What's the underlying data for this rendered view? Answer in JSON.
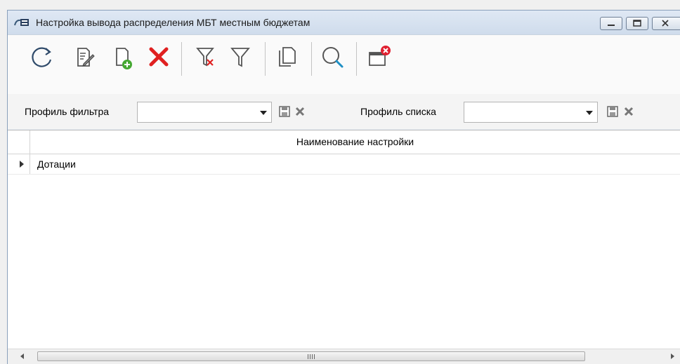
{
  "window": {
    "title": "Настройка вывода распределения МБТ местным бюджетам",
    "controls": [
      "minimize",
      "maximize",
      "close"
    ]
  },
  "toolbar": {
    "buttons": [
      {
        "name": "refresh",
        "icon": "refresh-icon"
      },
      {
        "name": "edit",
        "icon": "edit-document-icon"
      },
      {
        "name": "add",
        "icon": "add-document-icon"
      },
      {
        "name": "delete",
        "icon": "delete-icon",
        "color": "#e02020"
      },
      {
        "name": "clear-filter",
        "icon": "clear-filter-icon"
      },
      {
        "name": "filter",
        "icon": "filter-icon"
      },
      {
        "name": "copy",
        "icon": "copy-icon"
      },
      {
        "name": "search",
        "icon": "search-icon"
      },
      {
        "name": "close-window",
        "icon": "close-window-icon"
      }
    ]
  },
  "filters": {
    "filter_profile_label": "Профиль фильтра",
    "filter_profile_value": "",
    "list_profile_label": "Профиль списка",
    "list_profile_value": ""
  },
  "grid": {
    "columns": [
      "Наименование настройки"
    ],
    "rows": [
      {
        "name": "Дотации",
        "expandable": true
      }
    ]
  }
}
